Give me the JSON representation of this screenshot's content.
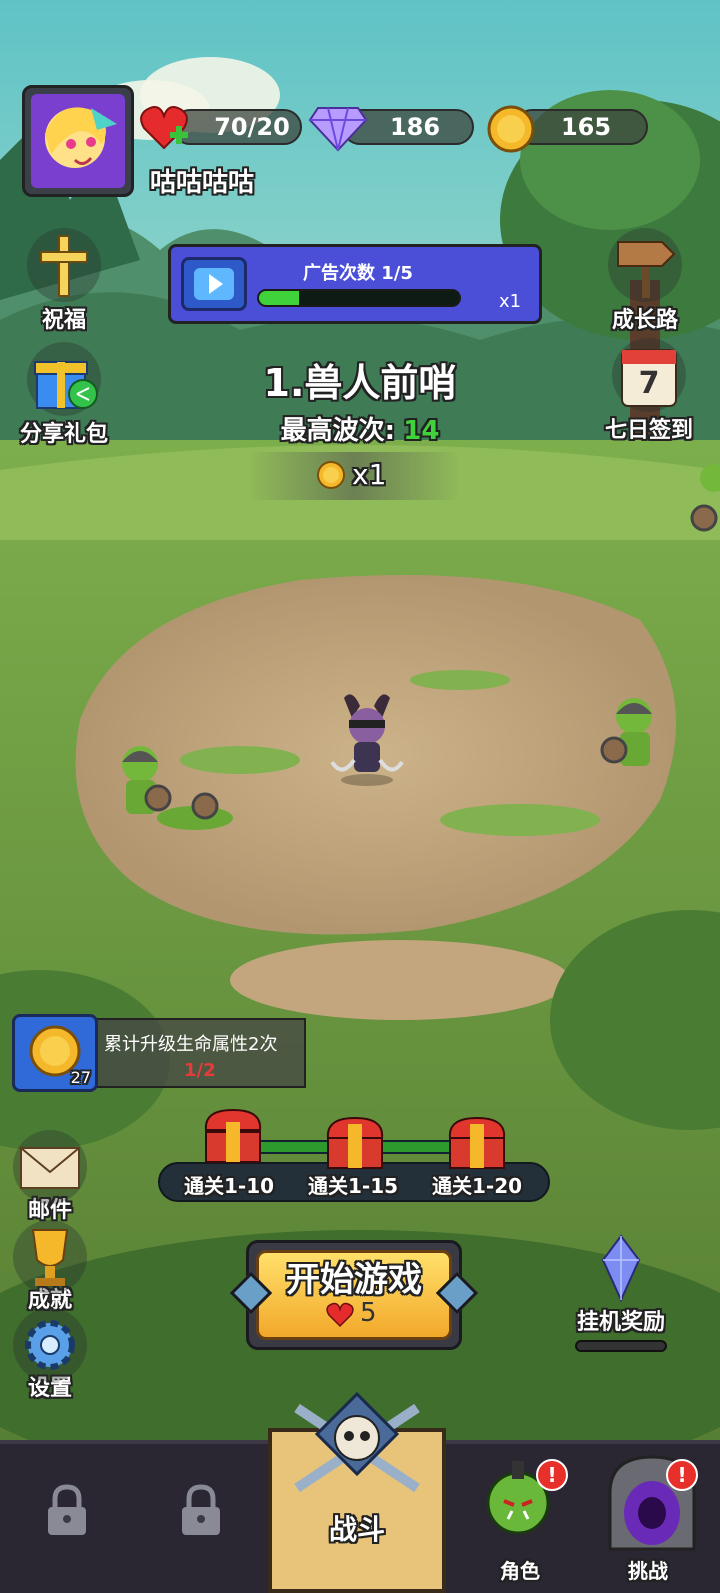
{
  "player": {
    "name": "咕咕咕咕"
  },
  "resources": {
    "energy": "70/20",
    "gems": "186",
    "coins": "165"
  },
  "ad_banner": {
    "title": "广告次数 1/5",
    "multiplier": "x1",
    "progress": 0.2
  },
  "left_menu": {
    "blessing": "祝福",
    "share_gift": "分享礼包",
    "mail": "邮件",
    "achievements": "成就",
    "settings": "设置"
  },
  "right_menu": {
    "growth_path": "成长路",
    "seven_day_checkin": "七日签到",
    "calendar_day": "7",
    "idle_reward": "挂机奖励"
  },
  "stage": {
    "name": "1.兽人前哨",
    "best_wave_label": "最高波次:",
    "best_wave_value": "14",
    "reward": "x1"
  },
  "task": {
    "text": "累计升级生命属性2次",
    "progress": "1/2",
    "reward_count": "27"
  },
  "chests": [
    "通关1-10",
    "通关1-15",
    "通关1-20"
  ],
  "start": {
    "label": "开始游戏",
    "cost": "5"
  },
  "bottom_nav": {
    "battle": "战斗",
    "character": "角色",
    "challenge": "挑战"
  },
  "colors": {
    "accent_green": "#3fd23a",
    "button_gold": "#f6c42f",
    "nav_bg": "#2a2632",
    "panel_blue": "#4b4fd8"
  }
}
